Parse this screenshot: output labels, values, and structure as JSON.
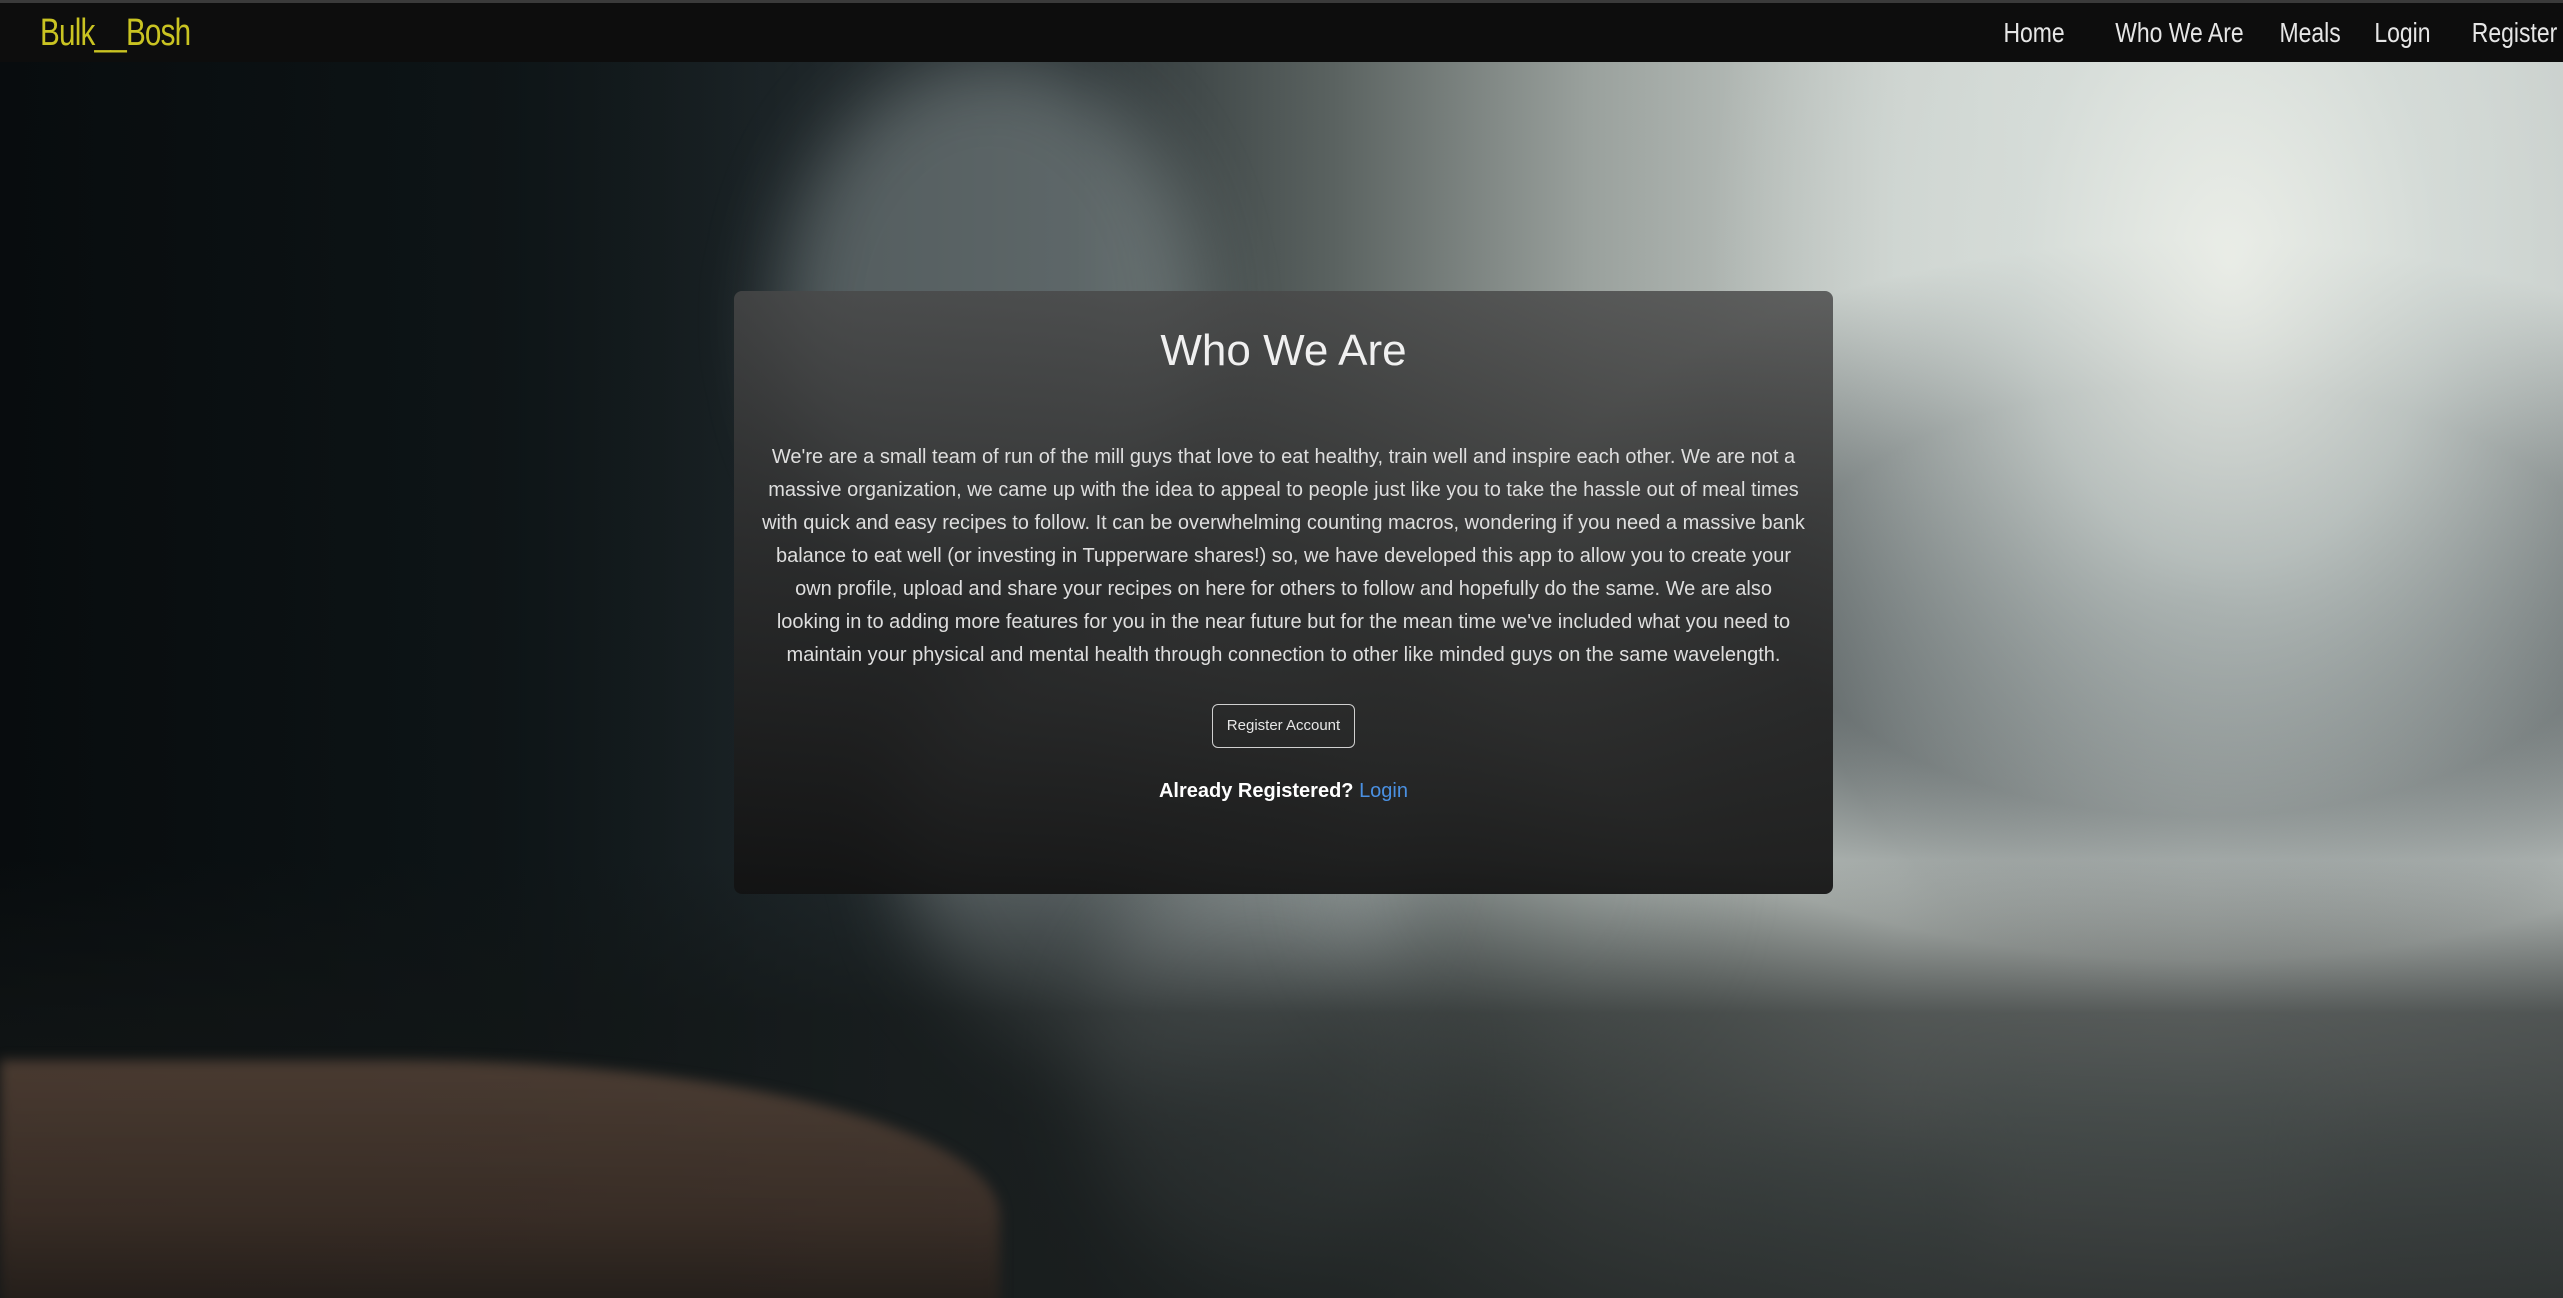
{
  "navbar": {
    "brand": "Bulk__Bosh",
    "links": [
      "Home",
      "Who We Are",
      "Meals",
      "Login",
      "Register"
    ]
  },
  "about": {
    "title": "Who We Are",
    "body": "We're are a small team of run of the mill guys that love to eat healthy, train well and inspire each other. We are not a massive organization, we came up with the idea to appeal to people just like you to take the hassle out of meal times with quick and easy recipes to follow. It can be overwhelming counting macros, wondering if you need a massive bank balance to eat well (or investing in Tupperware shares!) so, we have developed this app to allow you to create your own profile, upload and share your recipes on here for others to follow and hopefully do the same. We are also looking in to adding more features for you in the near future but for the mean time we've included what you need to maintain your physical and mental health through connection to other like minded guys on the same wavelength.",
    "register_button": "Register Account",
    "already_registered": "Already Registered?",
    "login_link": "Login"
  },
  "colors": {
    "brand": "#c9c322",
    "nav_background": "#0d0d0d",
    "link": "#4a90e2"
  }
}
